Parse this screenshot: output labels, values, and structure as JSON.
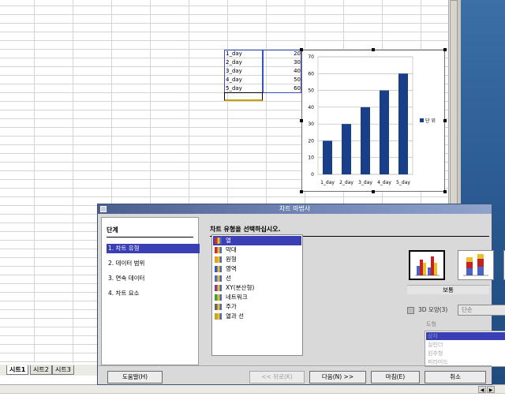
{
  "sheet": {
    "cells_a": [
      "1_day",
      "2_day",
      "3_day",
      "4_day",
      "5_day"
    ],
    "cells_b": [
      "20",
      "30",
      "40",
      "50",
      "60"
    ],
    "tabs": [
      "시트1",
      "시트2",
      "시트3"
    ],
    "active_tab": "시트1"
  },
  "chart_data": {
    "type": "bar",
    "categories": [
      "1_day",
      "2_day",
      "3_day",
      "4_day",
      "5_day"
    ],
    "series": [
      {
        "name": "단 위",
        "values": [
          20,
          30,
          40,
          50,
          60
        ]
      }
    ],
    "ylim": [
      0,
      70
    ],
    "yticks": [
      "0",
      "10",
      "20",
      "30",
      "40",
      "50",
      "60",
      "70"
    ],
    "grid": true,
    "legend": "right",
    "color": "#1a3f8a"
  },
  "dialog": {
    "title": "차트 마법사",
    "steps_title": "단계",
    "steps": [
      "1. 차트 유형",
      "2. 데이터 범위",
      "3. 연속 데이터",
      "4. 차트 요소"
    ],
    "active_step": 0,
    "heading": "차트 유형을 선택하십시오.",
    "chart_types": [
      {
        "label": "열",
        "icon": "column-chart-icon"
      },
      {
        "label": "막대",
        "icon": "bar-chart-icon"
      },
      {
        "label": "원형",
        "icon": "pie-chart-icon"
      },
      {
        "label": "영역",
        "icon": "area-chart-icon"
      },
      {
        "label": "선",
        "icon": "line-chart-icon"
      },
      {
        "label": "XY(분산형)",
        "icon": "xy-scatter-icon"
      },
      {
        "label": "네트워크",
        "icon": "net-chart-icon"
      },
      {
        "label": "주가",
        "icon": "stock-chart-icon"
      },
      {
        "label": "열과 선",
        "icon": "column-line-icon"
      }
    ],
    "selected_type": 0,
    "variant_label": "보통",
    "three_d_label": "3D 모양(3)",
    "look_value": "단순",
    "shape_label": "도형",
    "shapes": [
      "상자",
      "실린더",
      "원추형",
      "피라미드"
    ],
    "buttons": {
      "help": "도움말(H)",
      "back": "<< 뒤로(K)",
      "next": "다음(N) >>",
      "finish": "마침(E)",
      "cancel": "취소"
    }
  }
}
